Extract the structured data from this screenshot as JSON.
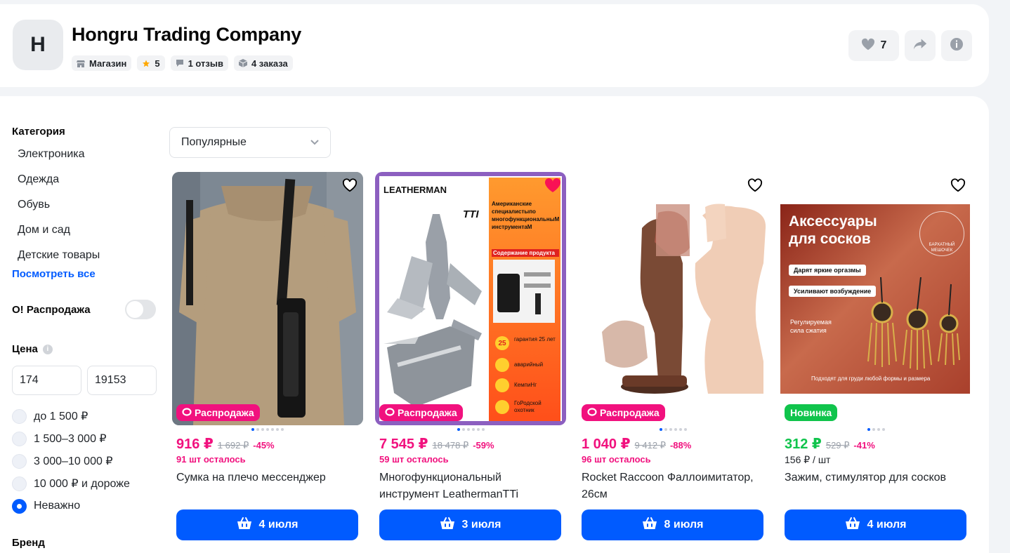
{
  "shop": {
    "initial": "H",
    "name": "Hongru Trading Company",
    "badges": {
      "store": "Магазин",
      "rating": "5",
      "reviews": "1 отзыв",
      "orders": "4 заказа"
    },
    "favorites_count": "7"
  },
  "sidebar": {
    "category_title": "Категория",
    "categories": [
      "Электроника",
      "Одежда",
      "Обувь",
      "Дом и сад",
      "Детские товары"
    ],
    "see_all": "Посмотреть все",
    "sale_label": "O! Распродажа",
    "price_title": "Цена",
    "price_info": "i",
    "price_min": "174",
    "price_max": "19153",
    "price_ranges": [
      "до 1 500 ₽",
      "1 500–3 000 ₽",
      "3 000–10 000 ₽",
      "10 000 ₽ и дороже",
      "Неважно"
    ],
    "brand_title": "Бренд"
  },
  "sort": {
    "selected": "Популярные"
  },
  "products": [
    {
      "tag": "Распродажа",
      "price": "916 ₽",
      "old_price": "1 692 ₽",
      "discount": "-45%",
      "stock": "91 шт осталось",
      "title": "Сумка на плечо мессенджер",
      "delivery": "4 июля"
    },
    {
      "tag": "Распродажа",
      "price": "7 545 ₽",
      "old_price": "18 478 ₽",
      "discount": "-59%",
      "stock": "59 шт осталось",
      "title": "Многофункциональный инструмент LeathermanTTi",
      "delivery": "3 июля",
      "image_text": {
        "brand": "LEATHERMAN",
        "model": "TTI",
        "spec": "Американские специалистыпо многофункциональныМ инструментаМ",
        "content": "Содержание продукта",
        "features": [
          "гарантия 25 лет",
          "аварийный",
          "КемпиНг",
          "ГоРодской охотник"
        ],
        "years": "25"
      }
    },
    {
      "tag": "Распродажа",
      "price": "1 040 ₽",
      "old_price": "9 412 ₽",
      "discount": "-88%",
      "stock": "96 шт осталось",
      "title": "Rocket Raccoon Фаллоимитатор, 26см",
      "delivery": "8 июля"
    },
    {
      "tag": "Новинка",
      "price": "312 ₽",
      "old_price": "529 ₽",
      "discount": "-41%",
      "stock": "156 ₽ / шт",
      "title": "Зажим, стимулятор для сосков",
      "delivery": "4 июля",
      "image_text": {
        "heading": "Аксессуары для сосков",
        "bag": "БАРХАТНЫЙ МЕШОЧЕК",
        "line1": "Дарят яркие оргазмы",
        "line2": "Усиливают возбуждение",
        "note": "Регулируемая сила сжатия",
        "footer": "Подходят для груди любой формы и размера"
      }
    }
  ],
  "colors": {
    "accent": "#005bff",
    "sale": "#f1117e",
    "new": "#10c44c"
  }
}
